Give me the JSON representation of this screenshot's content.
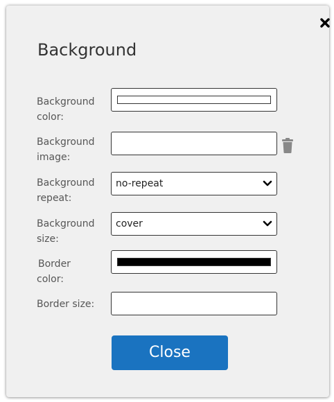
{
  "dialog": {
    "title": "Background",
    "close_icon": "close-x-icon",
    "fields": {
      "background_color": {
        "label_line1": "Background",
        "label_line2": "color:",
        "value": "#ffffff"
      },
      "background_image": {
        "label_line1": "Background",
        "label_line2": "image:",
        "value": "",
        "delete_icon": "trash-icon"
      },
      "background_repeat": {
        "label_line1": "Background",
        "label_line2": "repeat:",
        "selected": "no-repeat"
      },
      "background_size": {
        "label_line1": "Background",
        "label_line2": "size:",
        "selected": "cover"
      },
      "border_color": {
        "label_line1": "Border",
        "label_line2": "color:",
        "value": "#000000"
      },
      "border_size": {
        "label": "Border size:",
        "value": ""
      }
    },
    "close_button_label": "Close"
  },
  "colors": {
    "dialog_bg": "#f0f0f0",
    "button_bg": "#1a73c0",
    "label_text": "#555555",
    "title_text": "#333333",
    "icon_gray": "#888888"
  }
}
